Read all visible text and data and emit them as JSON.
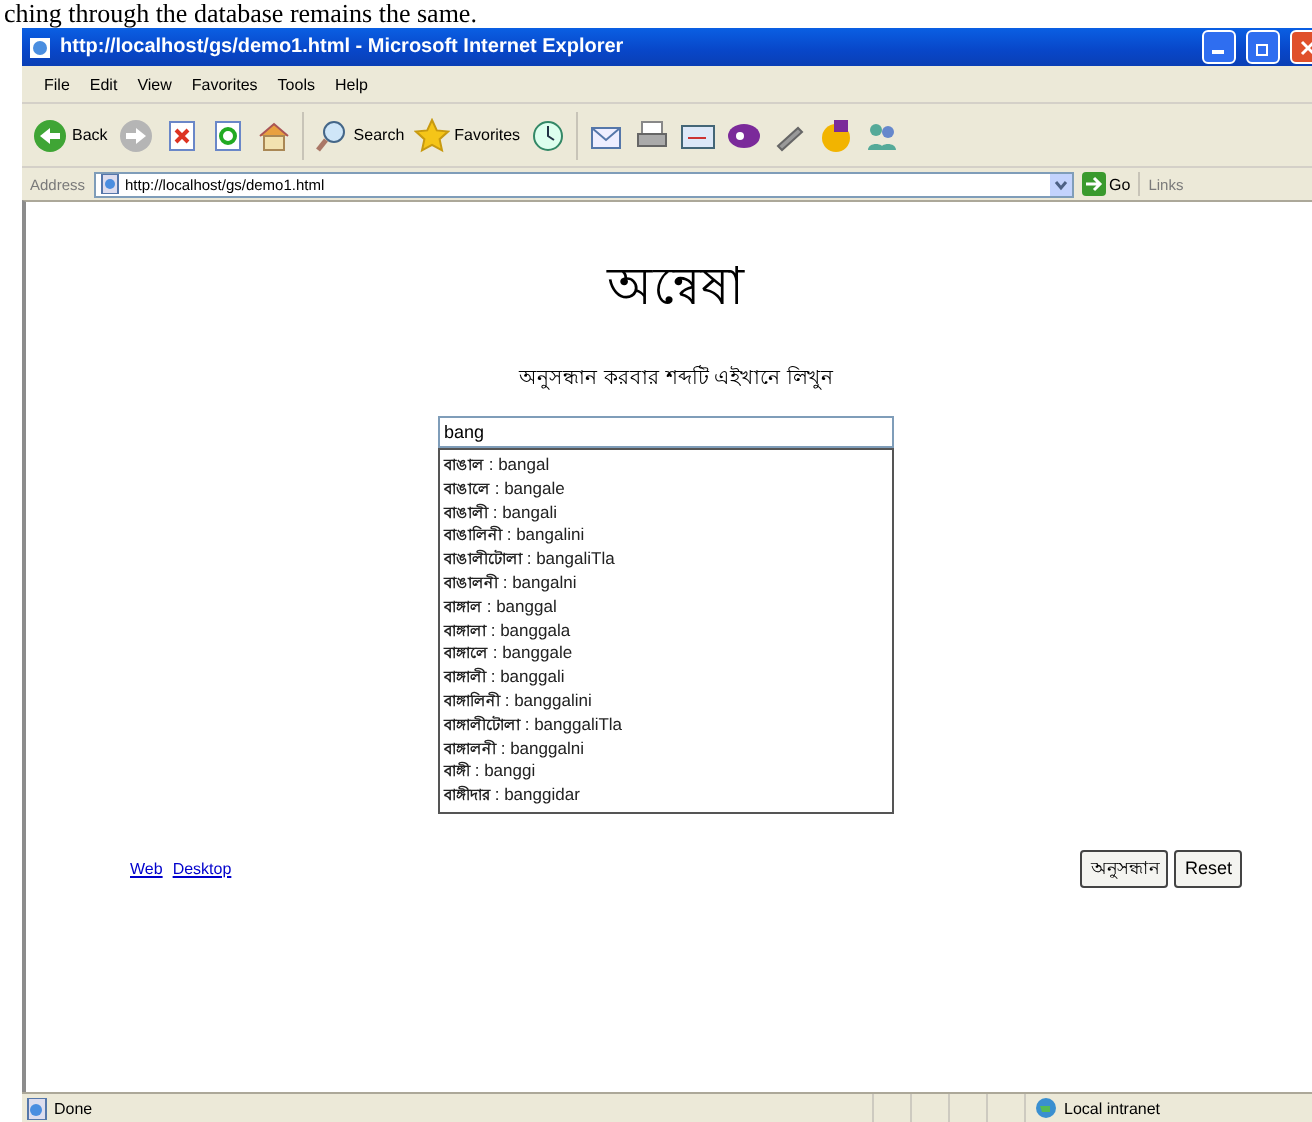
{
  "document_text": "ching through the database remains the same.",
  "window": {
    "title": "http://localhost/gs/demo1.html - Microsoft Internet Explorer"
  },
  "menu": [
    "File",
    "Edit",
    "View",
    "Favorites",
    "Tools",
    "Help"
  ],
  "toolbar": [
    {
      "kind": "back",
      "label": "Back"
    },
    {
      "kind": "forward"
    },
    {
      "kind": "stop"
    },
    {
      "kind": "refresh"
    },
    {
      "kind": "home"
    },
    {
      "kind": "search",
      "label": "Search"
    },
    {
      "kind": "favorites",
      "label": "Favorites"
    },
    {
      "kind": "history"
    },
    {
      "kind": "mail"
    },
    {
      "kind": "print"
    },
    {
      "kind": "edit"
    },
    {
      "kind": "yahoo"
    },
    {
      "kind": "wand"
    },
    {
      "kind": "messenger"
    },
    {
      "kind": "people"
    }
  ],
  "address": {
    "label": "Address",
    "url": "http://localhost/gs/demo1.html",
    "go": "Go",
    "links": "Links"
  },
  "page": {
    "title": "অন্বেষা",
    "prompt": "অনুসন্ধান করবার শব্দটি এইখানে লিখুন",
    "search": {
      "value": "bang"
    },
    "suggestions": [
      "**বাঙাল** : bangal",
      "**বাঙালে** : bangale",
      "**বাঙালী** : bangali",
      "**বাঙালিনী** : bangalini",
      "**বাঙালীটোলা** : bangaliTla",
      "**বাঙালনী** : bangalni",
      "**বাঙ্গাল** : banggal",
      "**বাঙ্গালা** : banggala",
      "**বাঙ্গালে** : banggale",
      "**বাঙ্গালী** : banggali",
      "**বাঙ্গালিনী** : banggalini",
      "**বাঙ্গালীটোলা** : banggaliTla",
      "**বাঙ্গালনী** : banggalni",
      "**বাঙ্গী** : banggi",
      "**বাঙ্গীদার** : banggidar"
    ],
    "links": [
      "Web",
      "Desktop"
    ],
    "buttons": [
      "অনুসন্ধান",
      "Reset"
    ]
  },
  "status_bar": {
    "text": "Done",
    "zone": "Local intranet"
  }
}
